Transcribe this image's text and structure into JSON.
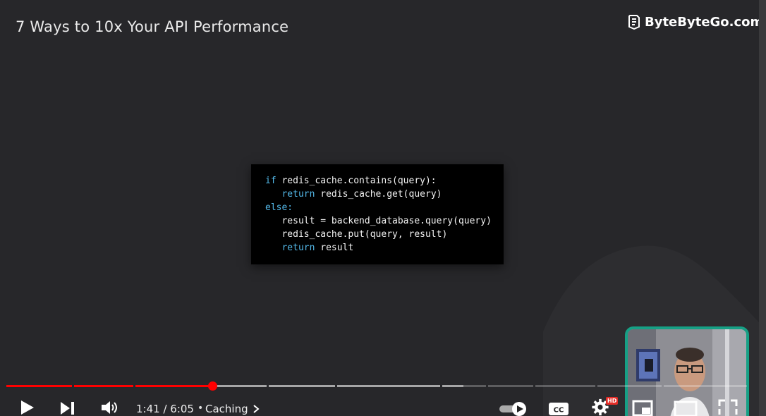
{
  "video": {
    "title": "7 Ways to 10x Your API Performance",
    "brand": "ByteByteGo.com"
  },
  "code": {
    "lines": [
      {
        "kw": "if",
        "text": " redis_cache.contains(query):",
        "indent": 0
      },
      {
        "kw": "return",
        "text": " redis_cache.get(query)",
        "indent": 1
      },
      {
        "kw": "else:",
        "text": "",
        "indent": 0
      },
      {
        "kw": "",
        "text": "result = backend_database.query(query)",
        "indent": 1
      },
      {
        "kw": "",
        "text": "redis_cache.put(query, result)",
        "indent": 1
      },
      {
        "kw": "return",
        "text": " result",
        "indent": 1
      }
    ]
  },
  "player": {
    "current_time": "1:41",
    "duration": "6:05",
    "time_text": "1:41 / 6:05",
    "separator": "•",
    "chapter": "Caching",
    "progress_fraction": 0.277,
    "hd_badge": "HD",
    "autoplay": true,
    "icons": [
      "play-icon",
      "next-icon",
      "volume-icon",
      "autoplay-toggle-icon",
      "captions-icon",
      "settings-icon",
      "miniplayer-icon",
      "theater-icon",
      "fullscreen-icon"
    ],
    "accent_color": "#ff0000",
    "webcam_border_color": "#16a085"
  }
}
